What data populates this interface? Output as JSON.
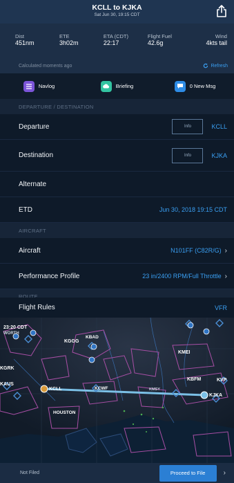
{
  "header": {
    "title": "KCLL to KJKA",
    "subtitle": "Sat Jun 30, 19:15 CDT"
  },
  "stats": [
    {
      "label": "Dist",
      "value": "451nm"
    },
    {
      "label": "ETE",
      "value": "3h02m"
    },
    {
      "label": "ETA (CDT)",
      "value": "22:17"
    },
    {
      "label": "Flight Fuel",
      "value": "42.6g"
    },
    {
      "label": "Wind",
      "value": "4kts tail"
    }
  ],
  "calc": {
    "text": "Calculated moments ago",
    "refresh": "Refresh"
  },
  "actions": [
    {
      "label": "Navlog",
      "color": "#7c55d8"
    },
    {
      "label": "Briefing",
      "color": "#33c4a1"
    },
    {
      "label": "0 New Msg",
      "color": "#2e8ce6"
    }
  ],
  "sections": {
    "dep_dest": "DEPARTURE / DESTINATION",
    "aircraft": "AIRCRAFT",
    "route": "ROUTE"
  },
  "rows": {
    "departure": {
      "label": "Departure",
      "info": "Info",
      "value": "KCLL"
    },
    "destination": {
      "label": "Destination",
      "info": "Info",
      "value": "KJKA"
    },
    "alternate": {
      "label": "Alternate"
    },
    "etd": {
      "label": "ETD",
      "value": "Jun 30, 2018 19:15 CDT"
    },
    "aircraft": {
      "label": "Aircraft",
      "value": "N101FF (C82R/G)"
    },
    "performance": {
      "label": "Performance Profile",
      "value": "23 in/2400 RPM/Full Throttle"
    },
    "flight_rules": {
      "label": "Flight Rules",
      "value": "VFR"
    }
  },
  "map": {
    "time_label": "23:20 CDT",
    "places": [
      "KGGG",
      "KBAD",
      "KMEI",
      "KCLL",
      "KJKA",
      "HOUSTON",
      "KBFM",
      "KVP",
      "KAUS",
      "KGRK"
    ],
    "partial_labels": [
      "WORTH",
      "KCWF",
      "KMSY"
    ]
  },
  "footer": {
    "status": "Not Filed",
    "button": "Proceed to File"
  }
}
